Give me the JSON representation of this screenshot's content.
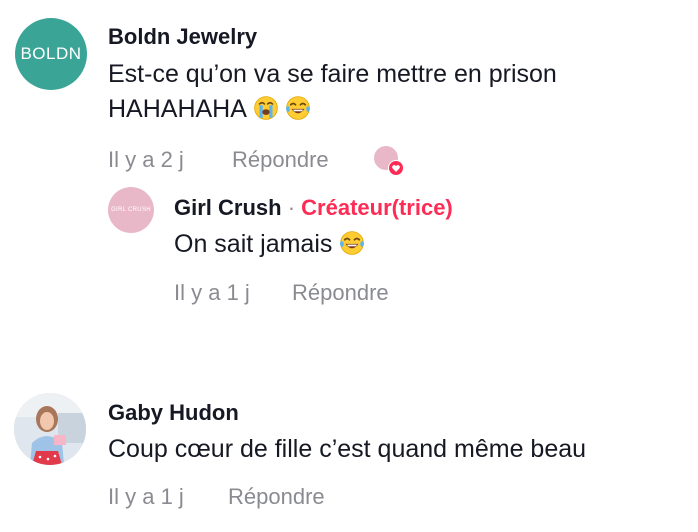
{
  "comments": [
    {
      "avatar_text": "BOLDN",
      "username": "Boldn Jewelry",
      "text_line1": "Est-ce qu’on va se faire mettre en prison",
      "text_line2": "HAHAHAHA",
      "emojis": [
        "loudly-crying-face",
        "face-with-tears-of-joy"
      ],
      "time": "Il y a 2 j",
      "reply_label": "Répondre",
      "liked_by_creator": true,
      "replies": [
        {
          "avatar_text": "GIRL CRUSH",
          "username": "Girl Crush",
          "separator": "·",
          "creator_label": "Créateur(trice)",
          "text": "On sait jamais",
          "emojis": [
            "face-with-tears-of-joy"
          ],
          "time": "Il y a 1 j",
          "reply_label": "Répondre"
        }
      ]
    },
    {
      "username": "Gaby Hudon",
      "text": "Coup cœur de fille c’est quand même beau",
      "time": "Il y a 1 j",
      "reply_label": "Répondre"
    }
  ],
  "colors": {
    "boldn_avatar": "#3aa596",
    "girlcrush_avatar": "#e9b8c8",
    "creator_accent": "#fe2c55",
    "meta_gray": "#8a8b91",
    "text": "#161823"
  }
}
